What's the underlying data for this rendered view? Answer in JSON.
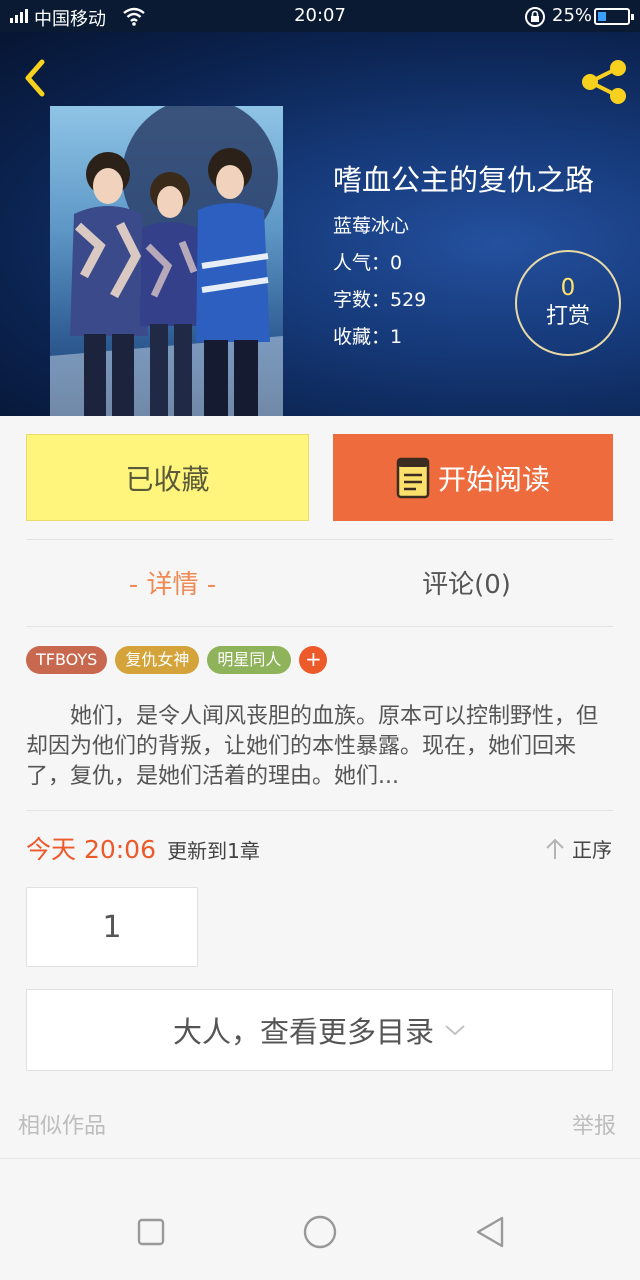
{
  "status_bar": {
    "carrier": "中国移动",
    "time": "20:07",
    "battery": "25%"
  },
  "book": {
    "title": "嗜血公主的复仇之路",
    "author": "蓝莓冰心",
    "popularity": "人气：0",
    "word_count": "字数：529",
    "favorites": "收藏：1"
  },
  "tip": {
    "count": "0",
    "label": "打赏"
  },
  "actions": {
    "favorite_label": "已收藏",
    "read_label": "开始阅读"
  },
  "tabs": {
    "detail": "- 详情 -",
    "comments": "评论(0)"
  },
  "tags": {
    "items": [
      "TFBOYS",
      "复仇女神",
      "明星同人"
    ],
    "add_symbol": "+"
  },
  "description": "她们，是令人闻风丧胆的血族。原本可以控制野性，但却因为他们的背叛，让她们的本性暴露。现在，她们回来了，复仇，是她们活着的理由。她们...",
  "update": {
    "time": "今天 20:06",
    "text": "更新到1章",
    "sort_label": "正序"
  },
  "chapter_list": {
    "items": [
      "1"
    ],
    "more_label": "大人，查看更多目录"
  },
  "footer": {
    "similar": "相似作品",
    "report": "举报"
  },
  "colors": {
    "accent": "#ec5a2a",
    "favorite_bg": "#fff57d",
    "read_bg": "#ed6b3d",
    "tab_active": "#f08a55",
    "hero_bg": "#163a7a"
  },
  "icons": [
    "back-icon",
    "share-icon",
    "book-icon",
    "sort-up-icon",
    "chevron-down-icon",
    "wifi-icon",
    "lock-rotation-icon",
    "battery-icon",
    "nav-square-icon",
    "nav-circle-icon",
    "nav-back-triangle-icon"
  ]
}
